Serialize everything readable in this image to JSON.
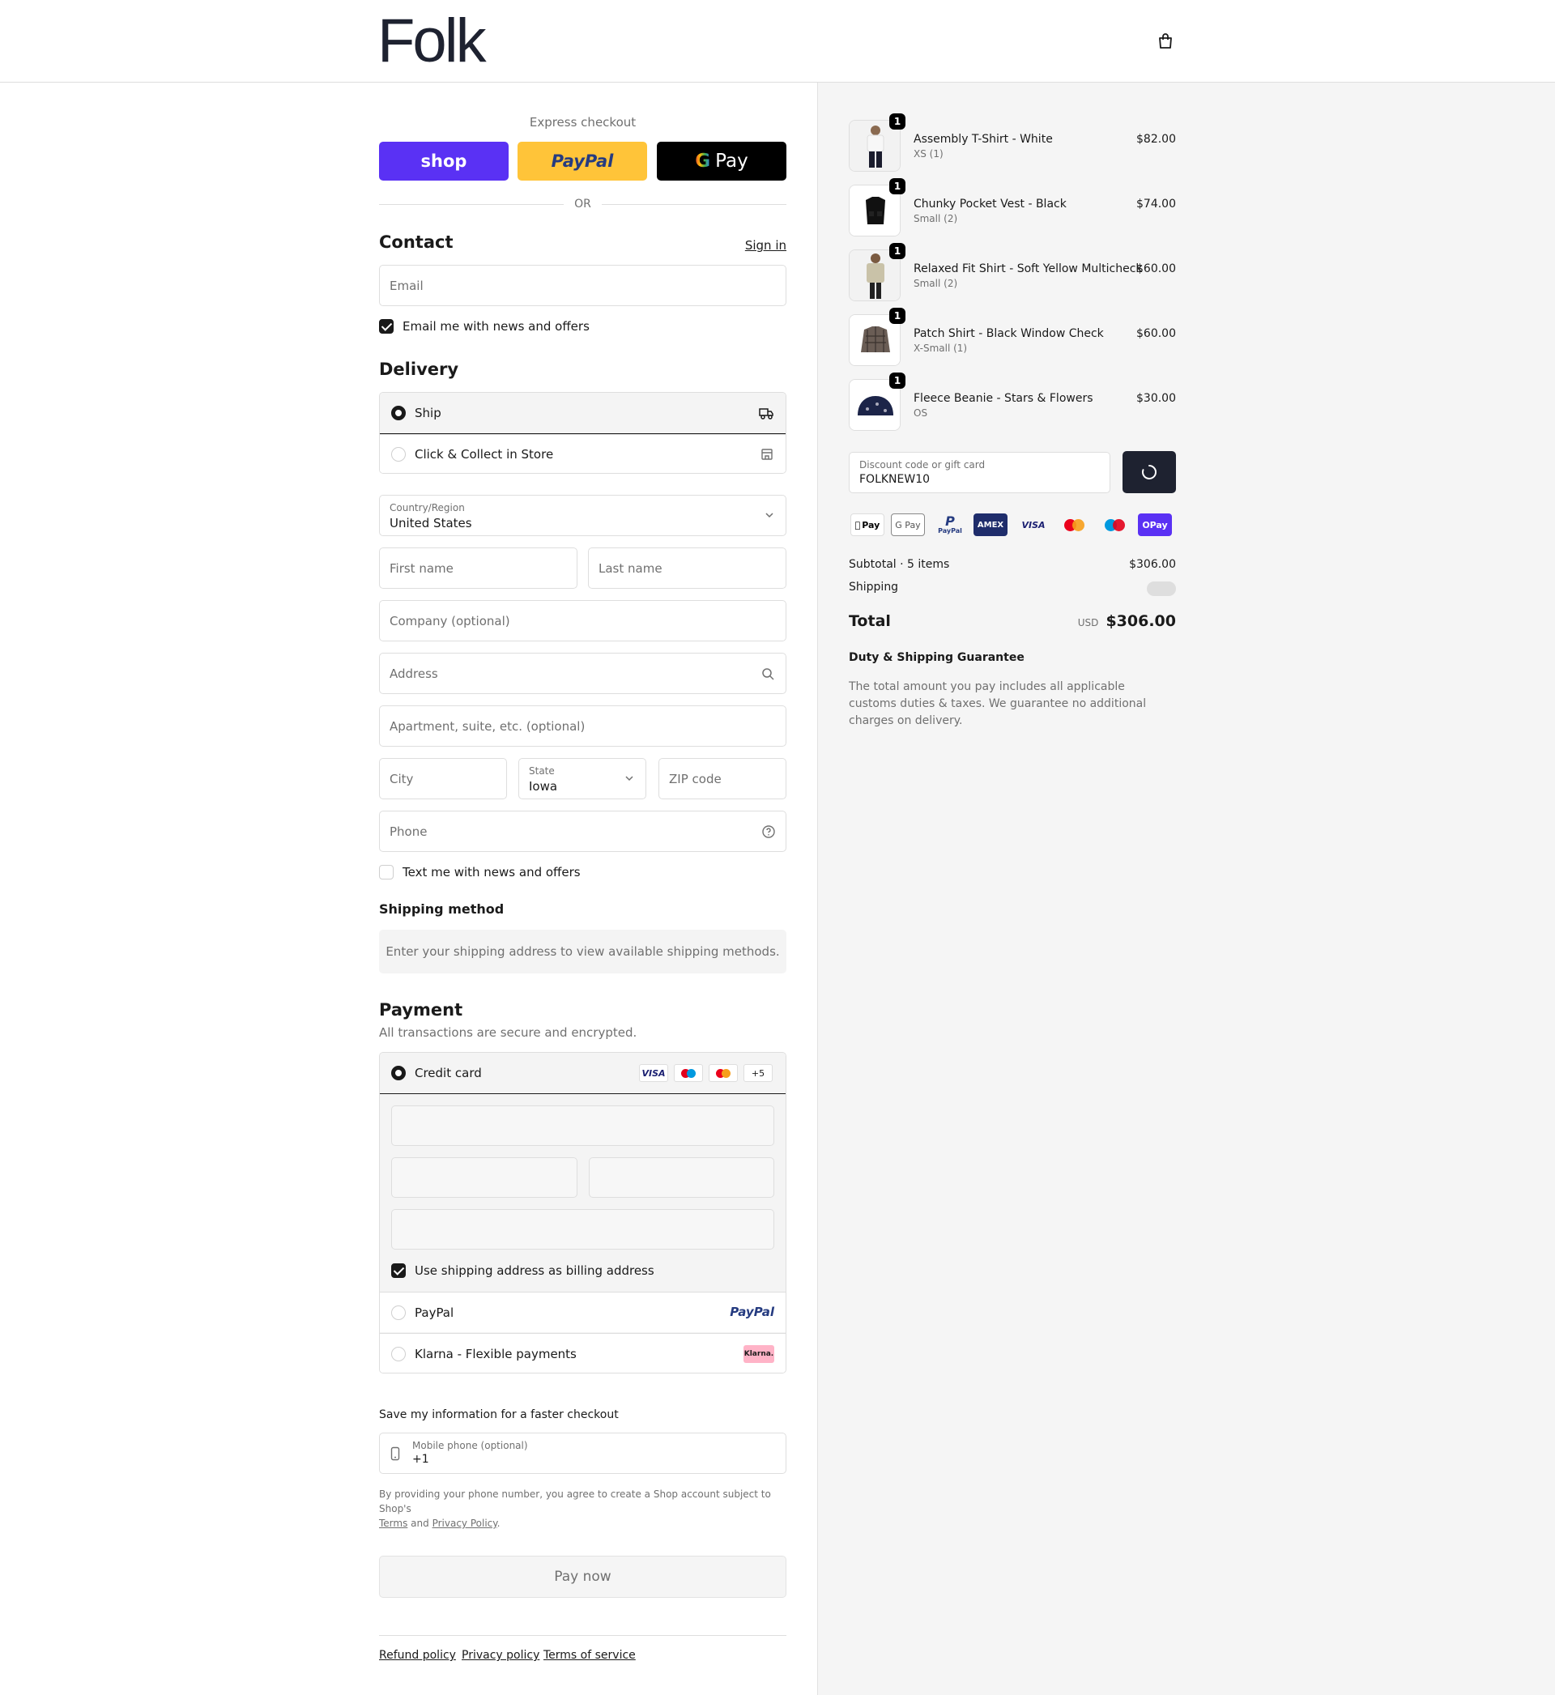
{
  "header": {
    "logo": "Folk"
  },
  "express": {
    "title": "Express checkout",
    "shop": "shop",
    "paypal": "PayPal",
    "gpay": "Pay",
    "or": "OR"
  },
  "contact": {
    "title": "Contact",
    "signin": "Sign in",
    "email_placeholder": "Email",
    "news_label": "Email me with news and offers"
  },
  "delivery": {
    "title": "Delivery",
    "options": [
      {
        "label": "Ship"
      },
      {
        "label": "Click & Collect in Store"
      }
    ],
    "country_label": "Country/Region",
    "country_value": "United States",
    "first_name": "First name",
    "last_name": "Last name",
    "company": "Company (optional)",
    "address": "Address",
    "apartment": "Apartment, suite, etc. (optional)",
    "city": "City",
    "state_label": "State",
    "state_value": "Iowa",
    "zip": "ZIP code",
    "phone": "Phone",
    "text_label": "Text me with news and offers"
  },
  "shipping_method": {
    "title": "Shipping method",
    "info": "Enter your shipping address to view available shipping methods."
  },
  "payment": {
    "title": "Payment",
    "subtitle": "All transactions are secure and encrypted.",
    "credit_card": "Credit card",
    "more_cards": "+5",
    "billing_label": "Use shipping address as billing address",
    "paypal": "PayPal",
    "paypal_logo": "PayPal",
    "klarna": "Klarna - Flexible payments",
    "klarna_logo": "Klarna."
  },
  "save": {
    "title": "Save my information for a faster checkout",
    "phone_label": "Mobile phone (optional)",
    "phone_value": "+1",
    "legal_1": "By providing your phone number, you agree to create a Shop account subject to Shop's",
    "terms": "Terms",
    "and": "and",
    "privacy": "Privacy Policy",
    "period": "."
  },
  "pay_now": "Pay now",
  "footer": {
    "refund": "Refund policy",
    "privacy": "Privacy policy",
    "terms": "Terms of service"
  },
  "cart": {
    "items": [
      {
        "name": "Assembly T-Shirt - White",
        "variant": "XS (1)",
        "price": "$82.00",
        "qty": "1"
      },
      {
        "name": "Chunky Pocket Vest - Black",
        "variant": "Small (2)",
        "price": "$74.00",
        "qty": "1"
      },
      {
        "name": "Relaxed Fit Shirt - Soft Yellow Multicheck",
        "variant": "Small (2)",
        "price": "$60.00",
        "qty": "1"
      },
      {
        "name": "Patch Shirt - Black Window Check",
        "variant": "X-Small (1)",
        "price": "$60.00",
        "qty": "1"
      },
      {
        "name": "Fleece Beanie - Stars & Flowers",
        "variant": "OS",
        "price": "$30.00",
        "qty": "1"
      }
    ],
    "discount_label": "Discount code or gift card",
    "discount_value": "FOLKNEW10",
    "payment_logos": [
      "Pay",
      "G Pay",
      "PayPal",
      "AMEX",
      "VISA",
      "mastercard",
      "Maestro",
      "OPay"
    ],
    "subtotal_label": "Subtotal · 5 items",
    "subtotal_value": "$306.00",
    "shipping_label": "Shipping",
    "total_label": "Total",
    "currency": "USD",
    "total_value": "$306.00",
    "guarantee_title": "Duty & Shipping Guarantee",
    "guarantee_text": "The total amount you pay includes all applicable customs duties & taxes. We guarantee no additional charges on delivery."
  }
}
